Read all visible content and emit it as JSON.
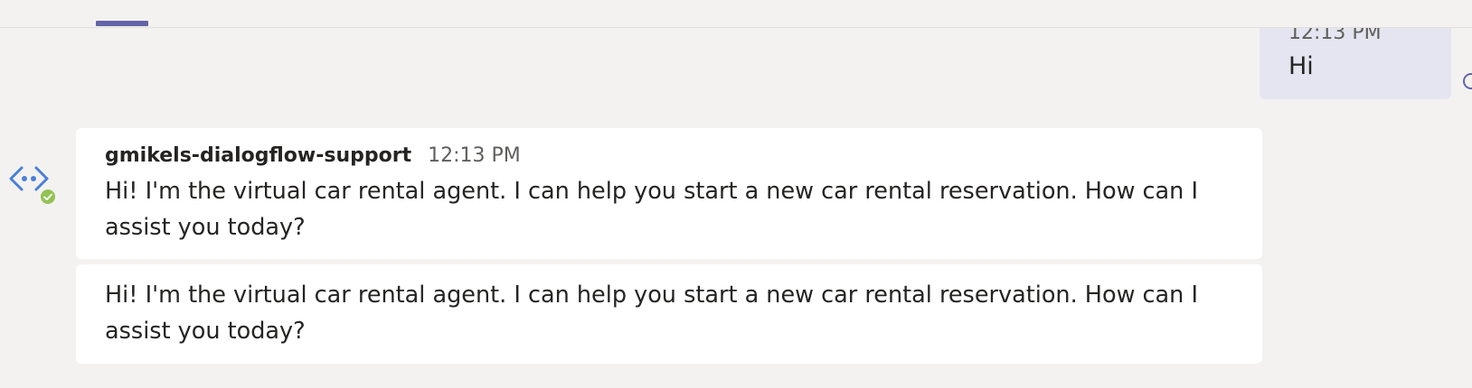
{
  "self_message": {
    "time": "12:13 PM",
    "text": "Hi"
  },
  "bot": {
    "sender": "gmikels-dialogflow-support",
    "avatar_icon": "bot-code-icon",
    "presence": "available",
    "presence_color": "#92c353",
    "messages": [
      {
        "time": "12:13 PM",
        "text": "Hi! I'm the virtual car rental agent. I can help you start a new car rental reservation. How can I assist you today?"
      },
      {
        "text": "Hi! I'm the virtual car rental agent. I can help you start a new car rental reservation. How can I assist you today?"
      }
    ]
  },
  "colors": {
    "accent": "#6264a7",
    "background": "#f3f2f1",
    "self_bubble": "#e5e5f1",
    "card": "#ffffff",
    "bot_icon": "#4a7fd8"
  }
}
